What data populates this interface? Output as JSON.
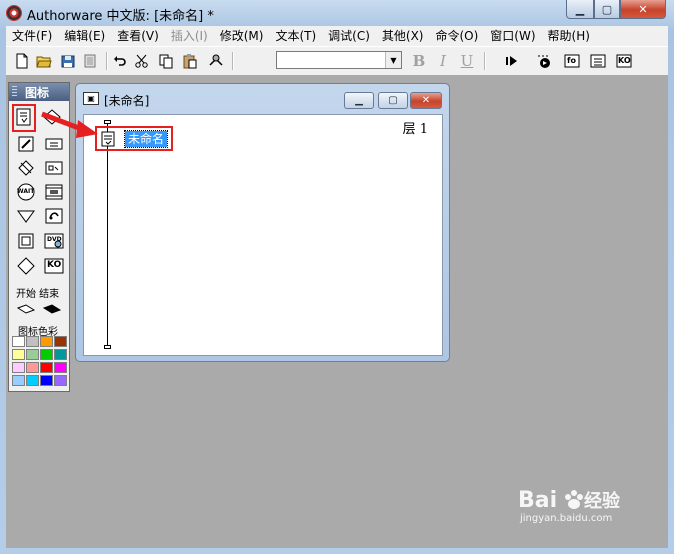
{
  "window": {
    "title": "Authorware 中文版: [未命名] *",
    "minimize": "▁",
    "maximize": "▢",
    "close": "✕"
  },
  "menu": [
    {
      "label": "文件(F)",
      "enabled": true
    },
    {
      "label": "编辑(E)",
      "enabled": true
    },
    {
      "label": "查看(V)",
      "enabled": true
    },
    {
      "label": "插入(I)",
      "enabled": false
    },
    {
      "label": "修改(M)",
      "enabled": true
    },
    {
      "label": "文本(T)",
      "enabled": true
    },
    {
      "label": "调试(C)",
      "enabled": true
    },
    {
      "label": "其他(X)",
      "enabled": true
    },
    {
      "label": "命令(O)",
      "enabled": true
    },
    {
      "label": "窗口(W)",
      "enabled": true
    },
    {
      "label": "帮助(H)",
      "enabled": true
    }
  ],
  "toolbar": {
    "font_value": "",
    "bold": "B",
    "italic": "I",
    "underline": "U",
    "fo_label": "fo",
    "ko_label": "KO"
  },
  "palette": {
    "title": "图标",
    "wait_label": "WAIT",
    "dvd_label": "DVD",
    "ko_label": "KO",
    "start_end": "开始 结束",
    "colors_label": "图标色彩",
    "swatches": [
      "#ffffff",
      "#c0c0c0",
      "#ff9900",
      "#993300",
      "#ffff99",
      "#99cc99",
      "#00cc00",
      "#009999",
      "#ffccff",
      "#ff9999",
      "#ff0000",
      "#ff00ff",
      "#99ccff",
      "#00ccff",
      "#0000ff",
      "#9966ff"
    ]
  },
  "child_window": {
    "title": "[未命名]",
    "layer": "层 1",
    "node_label": "未命名"
  },
  "colors": {
    "highlight": "#3399ff",
    "annotation": "#e62020"
  }
}
